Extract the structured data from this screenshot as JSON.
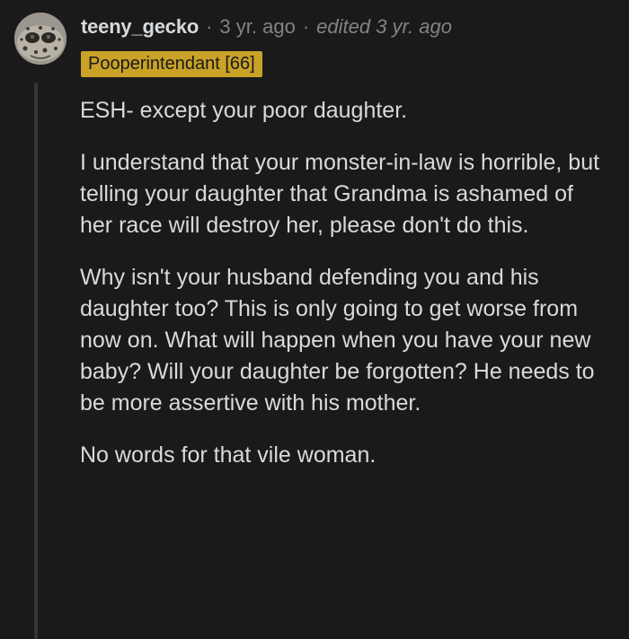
{
  "comment": {
    "username": "teeny_gecko",
    "separator": "·",
    "timestamp": "3 yr. ago",
    "edited": "edited 3 yr. ago",
    "flair": "Pooperintendant [66]",
    "paragraphs": [
      "ESH- except your poor daughter.",
      "I understand that your monster-in-law is horrible, but telling your daughter that Grandma is ashamed of her race will destroy her, please don't do this.",
      "Why isn't your husband defending you and his daughter too? This is only going to get worse from now on. What will happen when you have your new baby? Will your daughter be forgotten? He needs to be more assertive with his mother.",
      "No words for that vile woman."
    ]
  },
  "colors": {
    "background": "#1a1a1b",
    "text": "#d7dadc",
    "meta": "#818384",
    "flair_bg": "#c9a227",
    "thread_line": "#343536"
  }
}
